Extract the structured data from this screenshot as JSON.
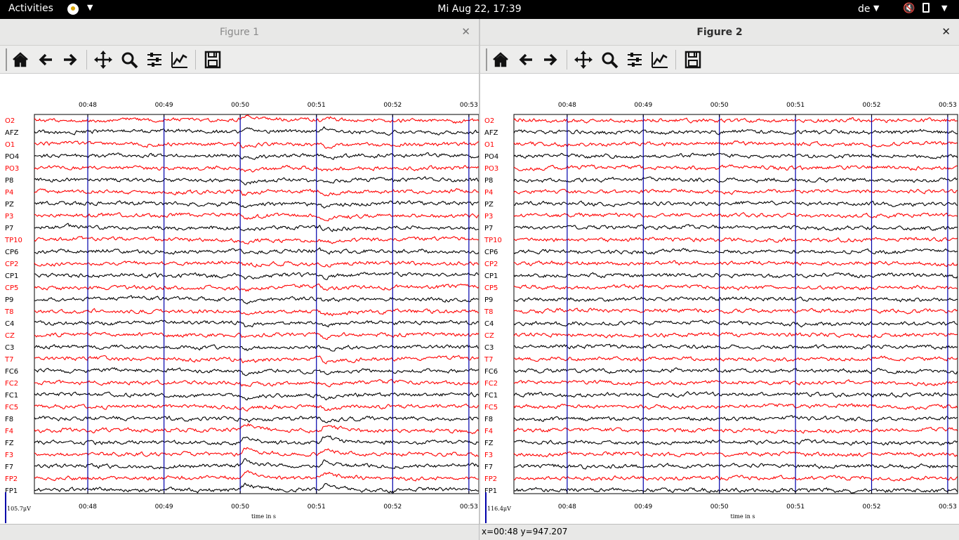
{
  "topbar": {
    "activities": "Activities",
    "clock": "Mi Aug 22, 17:39",
    "language": "de",
    "app_icon": "matplotlib-app-icon",
    "volume_icon": "volume-muted-icon",
    "battery_icon": "battery-icon"
  },
  "figures": [
    {
      "title": "Figure 1",
      "active": false,
      "scale_label": "105.7μV"
    },
    {
      "title": "Figure 2",
      "active": true,
      "scale_label": "116.4μV"
    }
  ],
  "toolbar_icons": [
    "home-icon",
    "back-arrow-icon",
    "forward-arrow-icon",
    "pan-icon",
    "zoom-icon",
    "subplots-icon",
    "edit-curves-icon",
    "save-icon"
  ],
  "colors": {
    "red": "#ff0000",
    "black": "#000000",
    "cursor_line": "#0000aa"
  },
  "status": {
    "coords": "x=00:48 y=947.207"
  },
  "chart_data": [
    {
      "type": "line",
      "title": "",
      "xlabel": "time in s",
      "ylabel": "",
      "x_ticks": [
        "00:48",
        "00:49",
        "00:50",
        "00:51",
        "00:52",
        "00:53"
      ],
      "x_tick_seconds": [
        48,
        49,
        50,
        51,
        52,
        53
      ],
      "xlim": [
        47.3,
        53.13
      ],
      "vertical_markers": [
        48,
        49,
        50,
        51,
        52,
        53
      ],
      "channels": [
        "O2",
        "AFZ",
        "O1",
        "PO4",
        "PO3",
        "P8",
        "P4",
        "PZ",
        "P3",
        "P7",
        "TP10",
        "CP6",
        "CP2",
        "CP1",
        "CP5",
        "P9",
        "T8",
        "C4",
        "CZ",
        "C3",
        "T7",
        "FC6",
        "FC2",
        "FC1",
        "FC5",
        "F8",
        "F4",
        "FZ",
        "F3",
        "F7",
        "FP2",
        "FP1"
      ],
      "channel_colors": [
        "red",
        "black"
      ],
      "scale_label": "105.7μV",
      "events": [
        50.0,
        51.05
      ]
    },
    {
      "type": "line",
      "title": "",
      "xlabel": "time in s",
      "ylabel": "",
      "x_ticks": [
        "00:48",
        "00:49",
        "00:50",
        "00:51",
        "00:52",
        "00:53"
      ],
      "x_tick_seconds": [
        48,
        49,
        50,
        51,
        52,
        53
      ],
      "xlim": [
        47.3,
        53.13
      ],
      "vertical_markers": [
        48,
        49,
        50,
        51,
        52,
        53
      ],
      "channels": [
        "O2",
        "AFZ",
        "O1",
        "PO4",
        "PO3",
        "P8",
        "P4",
        "PZ",
        "P3",
        "P7",
        "TP10",
        "CP6",
        "CP2",
        "CP1",
        "CP5",
        "P9",
        "T8",
        "C4",
        "CZ",
        "C3",
        "T7",
        "FC6",
        "FC2",
        "FC1",
        "FC5",
        "F8",
        "F4",
        "FZ",
        "F3",
        "F7",
        "FP2",
        "FP1"
      ],
      "channel_colors": [
        "red",
        "black"
      ],
      "scale_label": "116.4μV",
      "events": []
    }
  ]
}
